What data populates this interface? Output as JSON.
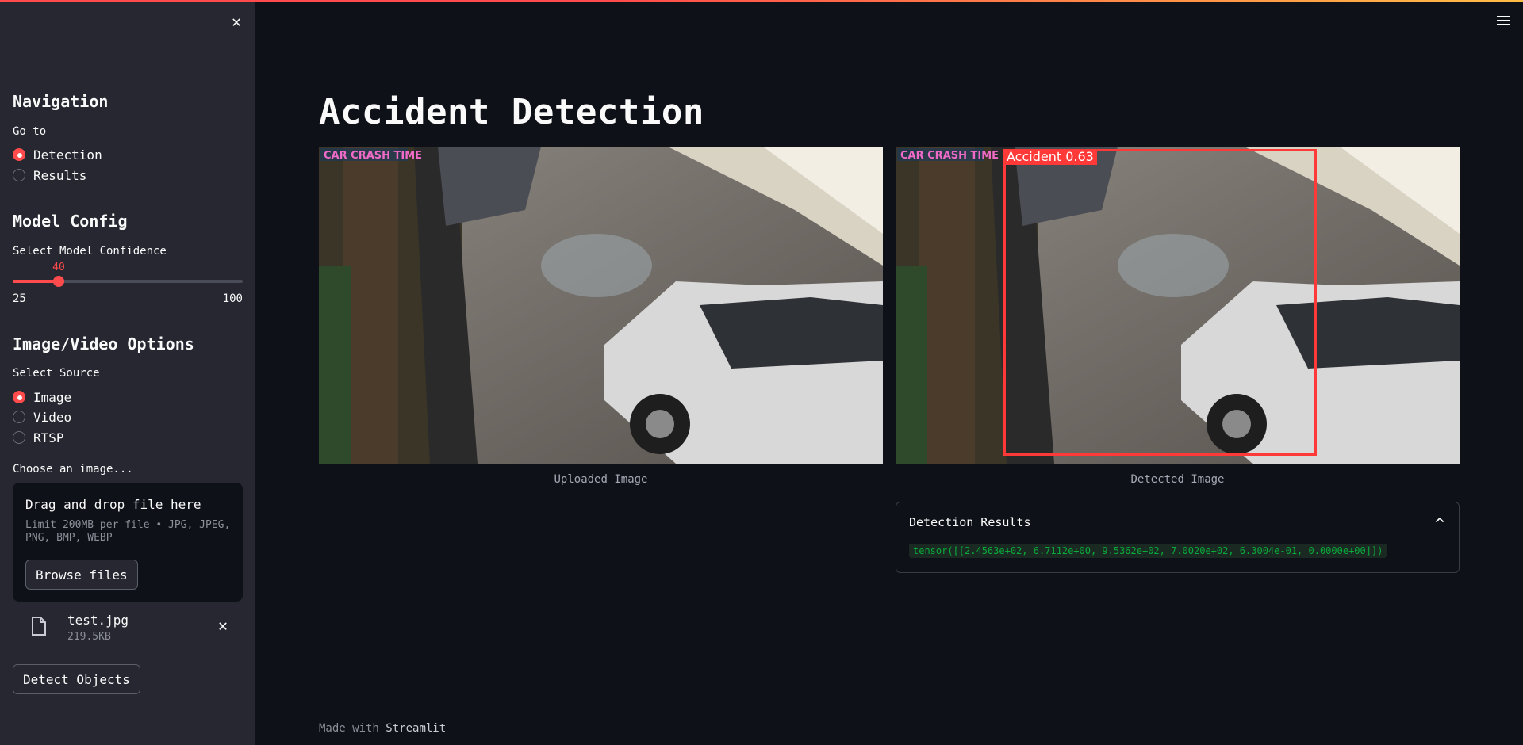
{
  "sidebar": {
    "navigation_heading": "Navigation",
    "goto_label": "Go to",
    "nav_options": [
      "Detection",
      "Results"
    ],
    "nav_selected": "Detection",
    "model_config_heading": "Model Config",
    "confidence_label": "Select Model Confidence",
    "confidence": {
      "value": 40,
      "min": 25,
      "max": 100
    },
    "source_heading": "Image/Video Options",
    "source_label": "Select Source",
    "source_options": [
      "Image",
      "Video",
      "RTSP"
    ],
    "source_selected": "Image",
    "uploader": {
      "label": "Choose an image...",
      "drag_text": "Drag and drop file here",
      "limit_text": "Limit 200MB per file • JPG, JPEG, PNG, BMP, WEBP",
      "browse_label": "Browse files"
    },
    "file": {
      "name": "test.jpg",
      "size": "219.5KB"
    },
    "detect_label": "Detect Objects"
  },
  "main": {
    "title": "Accident Detection",
    "uploaded_caption": "Uploaded Image",
    "detected_caption": "Detected Image",
    "bbox_label": "Accident 0.63",
    "watermark": "CAR CRASH TIME",
    "expander_title": "Detection Results",
    "tensor_text": "tensor([[2.4563e+02, 6.7112e+00, 9.5362e+02, 7.0020e+02, 6.3004e-01, 0.0000e+00]])"
  },
  "footer": {
    "prefix": "Made with",
    "brand": "Streamlit"
  },
  "colors": {
    "accent": "#ff4b4b",
    "sidebar_bg": "#262730",
    "main_bg": "#0e1117",
    "code_green": "#09ab3b",
    "bbox": "#ff3838"
  }
}
